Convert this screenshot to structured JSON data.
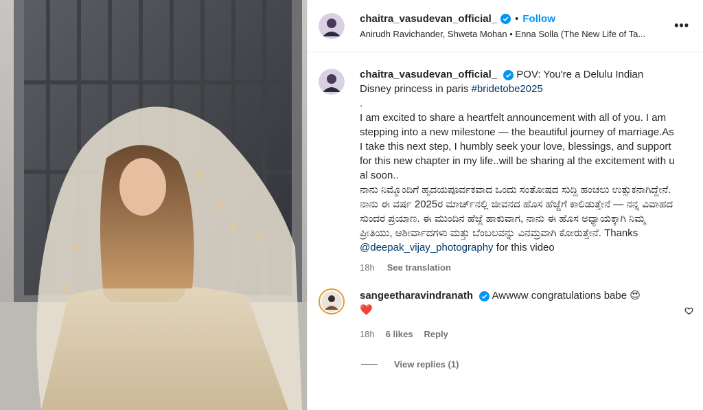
{
  "post": {
    "username": "chaitra_vasudevan_official_",
    "follow_label": "Follow",
    "dot": "•",
    "audio": "Anirudh Ravichander, Shweta Mohan • Enna Solla (The New Life of Ta...",
    "more_label": "•••"
  },
  "caption": {
    "username": "chaitra_vasudevan_official_",
    "line1": "POV: You're a Delulu Indian Disney princess in paris ",
    "hashtag": "#bridetobe2025",
    "dot_line": ".",
    "english": "I am excited to share a heartfelt announcement with all of you. I am stepping into a new milestone — the beautiful journey of marriage.As I take this next step, I humbly seek your love, blessings, and support for this new chapter in my life..will be sharing al the excitement with u al soon..",
    "kannada": "ನಾನು ನಿಮ್ಮೊಂದಿಗೆ ಹೃದಯಪೂರ್ವಕವಾದ ಒಂದು ಸಂತೋಷದ ಸುದ್ದಿ ಹಂಚಲು ಉತ್ಸುಕನಾಗಿದ್ದೇನೆ. ನಾನು ಈ ವರ್ಷ 2025ರ ಮಾರ್ಚ್‌ನಲ್ಲಿ ಜೀವನದ ಹೊಸ ಹೆಜ್ಜೆಗೆ ಕಾಲಿಡುತ್ತೇನೆ — ನನ್ನ ವಿವಾಹದ ಸುಂದರ ಪ್ರಯಾಣ. ಈ ಮುಂದಿನ ಹೆಜ್ಜೆ ಹಾಕುವಾಗ, ನಾನು ಈ ಹೊಸ ಅಧ್ಯಾಯಕ್ಕಾಗಿ ನಿಮ್ಮ ಪ್ರೀತಿಯು, ಆಶೀರ್ವಾದಗಳು ಮತ್ತು ಬೆಂಬಲವನ್ನು ವಿನಮ್ರವಾಗಿ ಕೋರುತ್ತೇನೆ. Thanks",
    "mention": "@deepak_vijay_photography",
    "tail": " for this video",
    "time": "18h",
    "see_translation": "See translation"
  },
  "comment": {
    "username": "sangeetharavindranath",
    "text": "Awwww congratulations babe 😍",
    "heart": "❤️",
    "time": "18h",
    "likes": "6 likes",
    "reply": "Reply",
    "view_replies": "View replies (1)"
  },
  "colors": {
    "link": "#0095f6",
    "mention": "#00376b",
    "muted": "#737373",
    "verified": "#0095f6"
  },
  "icons": {
    "verified": "verified-badge-icon",
    "more": "more-options-icon",
    "like": "heart-outline-icon"
  }
}
